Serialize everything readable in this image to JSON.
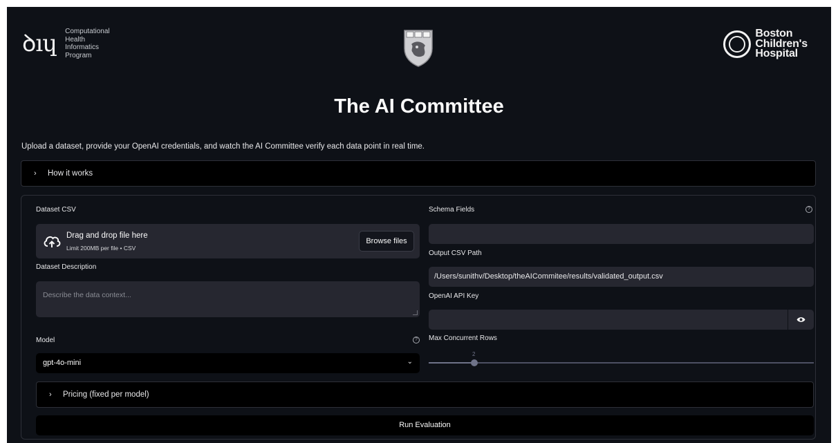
{
  "header": {
    "left_logo_mark": "ꝺıɥ",
    "left_logo_lines": [
      "Computational",
      "Health",
      "Informatics",
      "Program"
    ],
    "right_logo_lines": [
      "Boston",
      "Children's",
      "Hospital"
    ],
    "shield_motto": "VE RI TAS"
  },
  "page": {
    "title": "The AI Committee",
    "intro": "Upload a dataset, provide your OpenAI credentials, and watch the AI Committee verify each data point in real time."
  },
  "how_it_works": {
    "chevron": "›",
    "label": "How it works"
  },
  "form": {
    "dataset_csv": {
      "label": "Dataset CSV",
      "drop_title": "Drag and drop file here",
      "drop_subtitle": "Limit 200MB per file • CSV",
      "browse_label": "Browse files"
    },
    "dataset_description": {
      "label": "Dataset Description",
      "placeholder": "Describe the data context..."
    },
    "model": {
      "label": "Model",
      "value": "gpt-4o-mini",
      "caret": "⌄",
      "help": "?"
    },
    "pricing": {
      "chevron": "›",
      "label": "Pricing (fixed per model)"
    },
    "schema_fields": {
      "label": "Schema Fields",
      "value": "",
      "help": "?"
    },
    "output_csv_path": {
      "label": "Output CSV Path",
      "value": "/Users/sunithv/Desktop/theAICommitee/results/validated_output.csv"
    },
    "openai_api_key": {
      "label": "OpenAI API Key",
      "value": "",
      "reveal_icon": "eye-icon"
    },
    "max_concurrent_rows": {
      "label": "Max Concurrent Rows",
      "value": "2",
      "fraction": 0.12
    },
    "run_label": "Run Evaluation"
  },
  "colors": {
    "background": "#0e1117",
    "input": "#262730",
    "dark_control": "#000000",
    "slider": "#6f7389"
  }
}
